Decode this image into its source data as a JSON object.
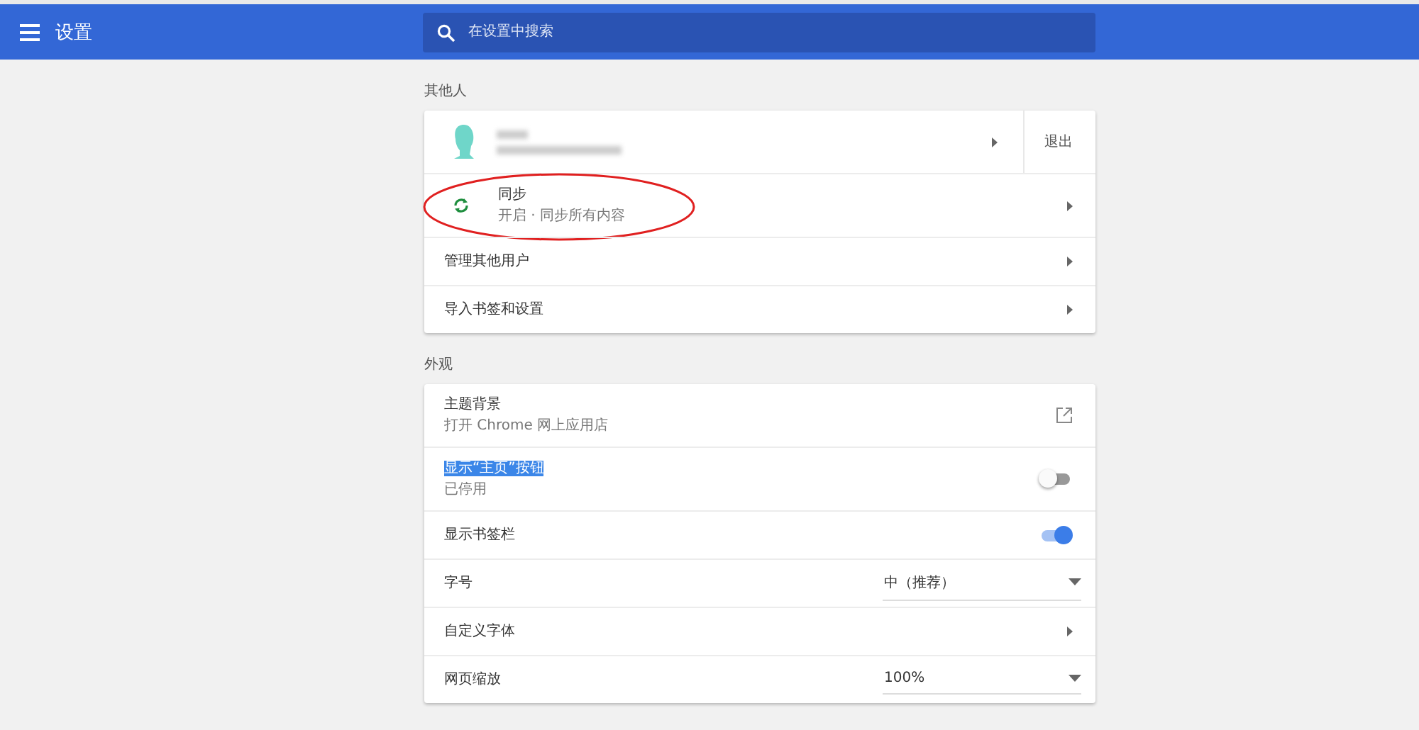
{
  "header": {
    "title": "设置",
    "search": {
      "placeholder": "在设置中搜索"
    }
  },
  "sections": [
    {
      "title": "其他人",
      "rows": [
        {
          "kind": "profile",
          "action": "退出"
        },
        {
          "kind": "sync",
          "label": "同步",
          "sublabel": "开启 · 同步所有内容",
          "circled": true
        },
        {
          "kind": "arrow",
          "label": "管理其他用户"
        },
        {
          "kind": "arrow",
          "label": "导入书签和设置"
        }
      ]
    },
    {
      "title": "外观",
      "rows": [
        {
          "kind": "external",
          "label": "主题背景",
          "sublabel": "打开 Chrome 网上应用店"
        },
        {
          "kind": "toggle",
          "label": "显示“主页”按钮",
          "sublabel": "已停用",
          "on": false,
          "highlighted": true
        },
        {
          "kind": "toggle",
          "label": "显示书签栏",
          "on": true,
          "highlighted": false
        },
        {
          "kind": "select",
          "label": "字号",
          "value": "中（推荐）"
        },
        {
          "kind": "arrow",
          "label": "自定义字体"
        },
        {
          "kind": "select",
          "label": "网页缩放",
          "value": "100%"
        }
      ]
    }
  ]
}
